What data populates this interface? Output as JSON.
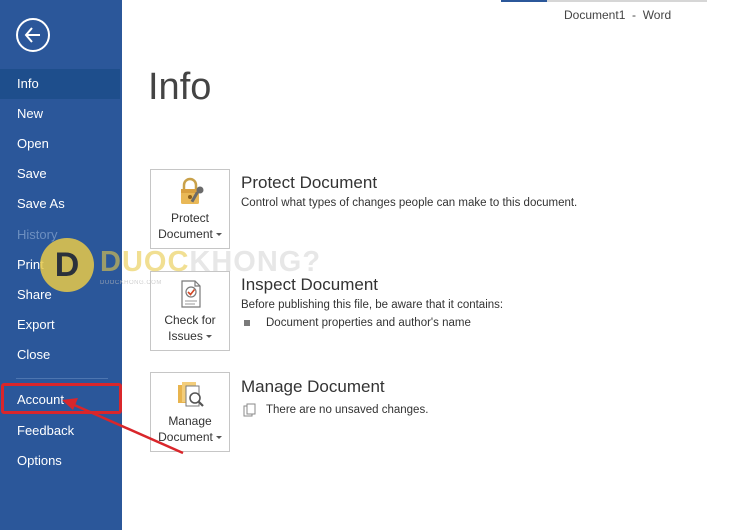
{
  "window": {
    "title": "Document1  -  Word"
  },
  "sidebar": {
    "back_icon": "back-arrow-icon",
    "items": [
      {
        "label": "Info",
        "state": "active"
      },
      {
        "label": "New",
        "state": "normal"
      },
      {
        "label": "Open",
        "state": "normal"
      },
      {
        "label": "Save",
        "state": "normal"
      },
      {
        "label": "Save As",
        "state": "normal"
      },
      {
        "label": "History",
        "state": "disabled"
      },
      {
        "label": "Print",
        "state": "normal"
      },
      {
        "label": "Share",
        "state": "normal"
      },
      {
        "label": "Export",
        "state": "normal"
      },
      {
        "label": "Close",
        "state": "normal"
      },
      {
        "label": "Account",
        "state": "highlighted"
      },
      {
        "label": "Feedback",
        "state": "normal"
      },
      {
        "label": "Options",
        "state": "normal"
      }
    ]
  },
  "main": {
    "title": "Info",
    "sections": [
      {
        "tile_line1": "Protect",
        "tile_line2": "Document",
        "title": "Protect Document",
        "description": "Control what types of changes people can make to this document.",
        "icon": "padlock-key-icon"
      },
      {
        "tile_line1": "Check for",
        "tile_line2": "Issues",
        "title": "Inspect Document",
        "description": "Before publishing this file, be aware that it contains:",
        "bullet": "Document properties and author's name",
        "icon": "document-check-icon"
      },
      {
        "tile_line1": "Manage",
        "tile_line2": "Document",
        "title": "Manage Document",
        "note": "There are no unsaved changes.",
        "icon": "manage-document-icon"
      }
    ]
  },
  "watermark": {
    "letter": "D",
    "text_part1": "DUOC",
    "text_part2": "KHONG?",
    "subtext": "DUOCKHONG.COM"
  },
  "colors": {
    "sidebar": "#2b579a",
    "sidebar_active": "#1e4e8c",
    "highlight": "#d9262b"
  }
}
